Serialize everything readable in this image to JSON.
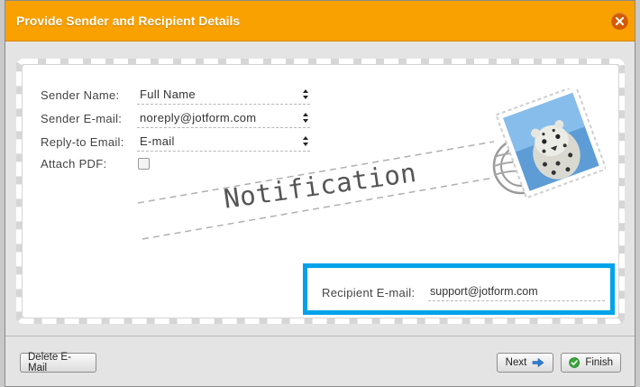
{
  "dialog": {
    "title": "Provide Sender and Recipient Details",
    "accent_color": "#f9a100",
    "close_icon": "close-icon"
  },
  "form": {
    "sender_name": {
      "label": "Sender Name:",
      "value": "Full Name"
    },
    "sender_email": {
      "label": "Sender E-mail:",
      "value": "noreply@jotform.com"
    },
    "reply_to": {
      "label": "Reply-to Email:",
      "value": "E-mail"
    },
    "attach_pdf": {
      "label": "Attach PDF:",
      "checked": false
    }
  },
  "envelope": {
    "heading": "Notification",
    "stamp_icon": "leopard-stamp-icon"
  },
  "recipient": {
    "label": "Recipient E-mail:",
    "value": "support@jotform.com",
    "highlight_color": "#00a3e8"
  },
  "footer": {
    "delete_label": "Delete E-Mail",
    "next_label": "Next",
    "finish_label": "Finish"
  }
}
